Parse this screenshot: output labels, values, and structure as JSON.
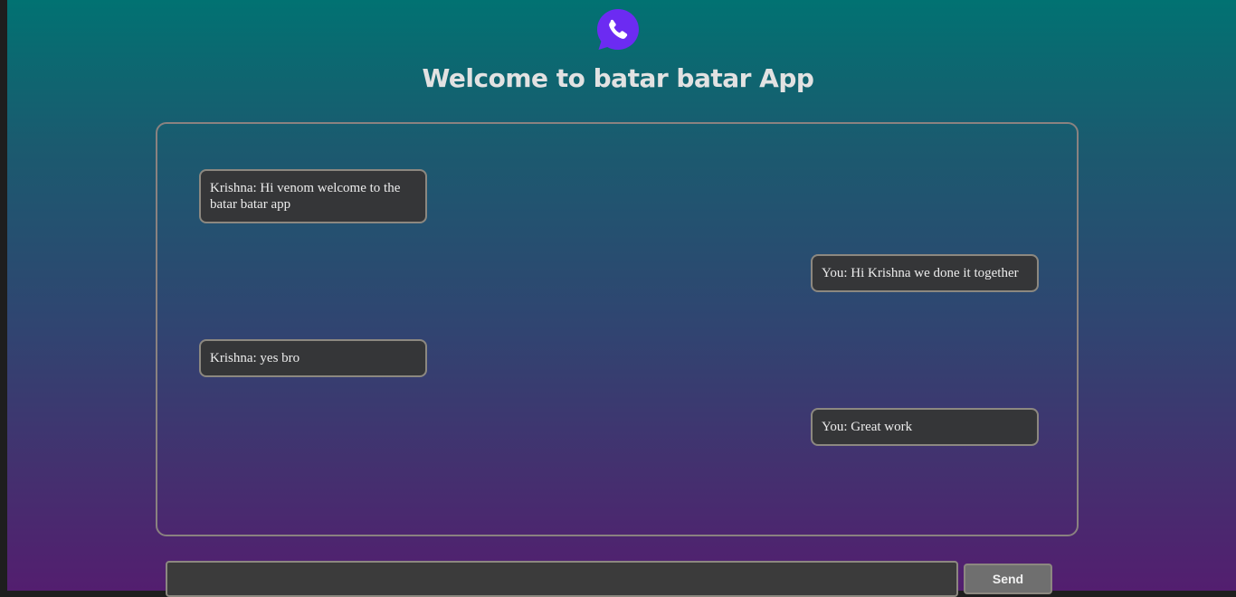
{
  "header": {
    "logo_icon": "whatsapp-phone-icon",
    "title": "Welcome to batar batar App"
  },
  "colors": {
    "logo": "#6c2bf2",
    "bubble_bg": "#353638",
    "border": "#8c8880",
    "gradient_top": "#017272",
    "gradient_bottom": "#531e6f"
  },
  "messages": [
    {
      "side": "left",
      "text": "Krishna: Hi venom welcome to the batar batar app"
    },
    {
      "side": "right",
      "text": "You: Hi Krishna we done it together"
    },
    {
      "side": "left",
      "text": "Krishna: yes bro"
    },
    {
      "side": "right",
      "text": "You: Great work"
    }
  ],
  "composer": {
    "input_value": "",
    "input_placeholder": "",
    "send_label": "Send"
  }
}
